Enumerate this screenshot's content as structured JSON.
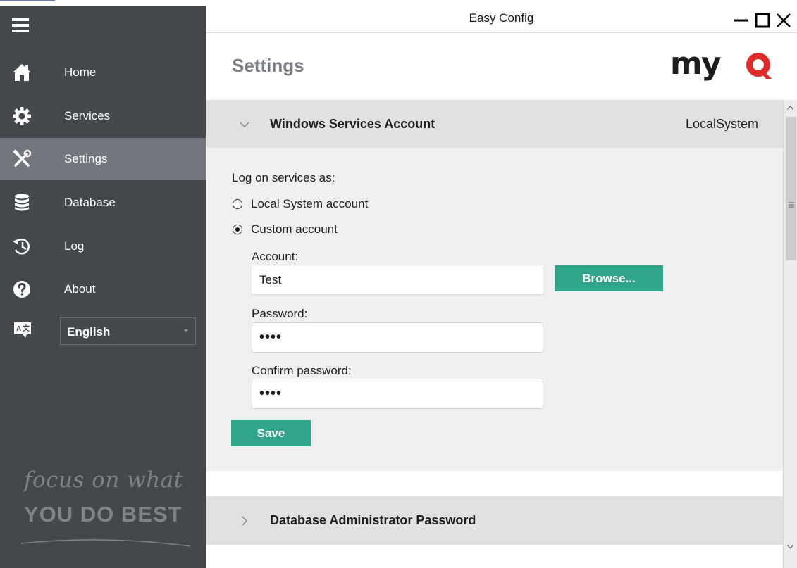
{
  "window": {
    "title": "Easy Config"
  },
  "sidebar": {
    "items": [
      {
        "label": "Home",
        "icon": "home-icon",
        "active": false
      },
      {
        "label": "Services",
        "icon": "gear-icon",
        "active": false
      },
      {
        "label": "Settings",
        "icon": "tools-icon",
        "active": true
      },
      {
        "label": "Database",
        "icon": "database-icon",
        "active": false
      },
      {
        "label": "Log",
        "icon": "history-icon",
        "active": false
      },
      {
        "label": "About",
        "icon": "question-icon",
        "active": false
      }
    ],
    "language": {
      "icon": "translate-icon",
      "value": "English"
    },
    "slogan": {
      "line1": "focus on what",
      "line2": "YOU DO BEST"
    }
  },
  "header": {
    "title": "Settings",
    "logo": "myQ"
  },
  "sections": {
    "windows_services": {
      "title": "Windows Services Account",
      "value": "LocalSystem",
      "expanded": true,
      "logon_label": "Log on services as:",
      "options": [
        {
          "label": "Local System account",
          "checked": false
        },
        {
          "label": "Custom account",
          "checked": true
        }
      ],
      "account_label": "Account:",
      "account_value": "Test",
      "browse_label": "Browse...",
      "password_label": "Password:",
      "password_value": "••••",
      "confirm_label": "Confirm password:",
      "confirm_value": "••••",
      "save_label": "Save"
    },
    "db_admin": {
      "title": "Database Administrator Password",
      "expanded": false
    }
  },
  "colors": {
    "sidebar_bg": "#44474c",
    "sidebar_active": "#73777d",
    "accent_green": "#2fa58a",
    "logo_red": "#e02b2b",
    "section_header_bg": "#e1e1e1",
    "section_body_bg": "#f0f0f0"
  }
}
